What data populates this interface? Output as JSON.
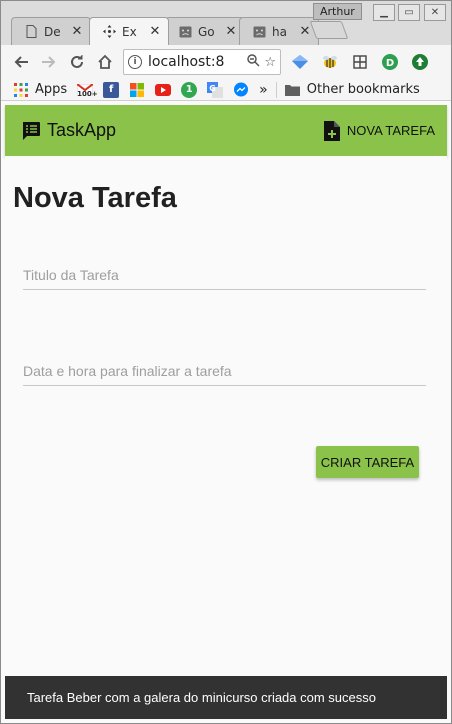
{
  "browser": {
    "tabs": [
      {
        "title": "De",
        "icon": "document-icon"
      },
      {
        "title": "Ex",
        "icon": "move-icon"
      },
      {
        "title": "Go",
        "icon": "sad-face-icon"
      },
      {
        "title": "ha",
        "icon": "sad-face-icon"
      }
    ],
    "user_name": "Arthur",
    "url": "localhost:8",
    "bookmarks": [
      {
        "label": "Apps",
        "icon": "apps-grid-icon"
      },
      {
        "label": "",
        "icon": "gmail-icon",
        "badge": "100+"
      },
      {
        "label": "",
        "icon": "facebook-icon"
      },
      {
        "label": "",
        "icon": "microsoft-icon"
      },
      {
        "label": "",
        "icon": "youtube-icon"
      },
      {
        "label": "",
        "icon": "one-icon"
      },
      {
        "label": "",
        "icon": "translate-icon"
      },
      {
        "label": "",
        "icon": "messenger-icon"
      }
    ],
    "more_bookmarks": "»",
    "other_bookmarks": "Other bookmarks"
  },
  "app": {
    "brand": "TaskApp",
    "nova_tarefa_label": "NOVA TAREFA",
    "accent_color": "#8bc34a"
  },
  "form": {
    "title": "Nova Tarefa",
    "title_placeholder": "Titulo da Tarefa",
    "datetime_placeholder": "Data e hora para finalizar a tarefa",
    "submit_label": "CRIAR TAREFA"
  },
  "snackbar": {
    "message": "Tarefa Beber com a galera do minicurso criada com sucesso"
  }
}
